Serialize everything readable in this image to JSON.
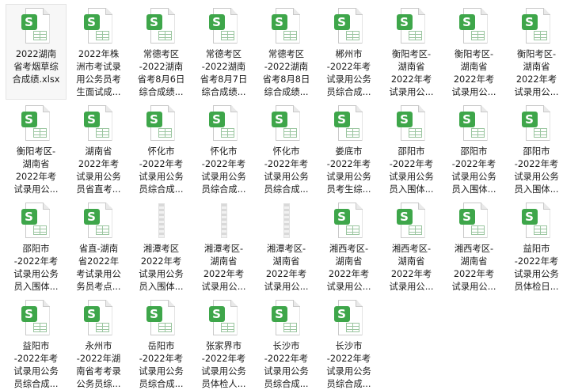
{
  "files": [
    {
      "name": "2022湖南省考烟草综合成绩.xlsx",
      "display": "2022湖南\n省考烟草综\n合成绩.xlsx",
      "icon": "spreadsheet-icon",
      "selected": true
    },
    {
      "name": "2022年株洲市考试录用公务员考生面试成...",
      "display": "2022年株\n洲市考试录\n用公务员考\n生面试成...",
      "icon": "spreadsheet-icon"
    },
    {
      "name": "常德考区-2022湖南省考8月6日综合成绩...",
      "display": "常德考区\n-2022湖南\n省考8月6日\n综合成绩...",
      "icon": "spreadsheet-icon"
    },
    {
      "name": "常德考区-2022湖南省考8月7日综合成绩...",
      "display": "常德考区\n-2022湖南\n省考8月7日\n综合成绩...",
      "icon": "spreadsheet-icon"
    },
    {
      "name": "常德考区-2022湖南省考8月8日综合成绩...",
      "display": "常德考区\n-2022湖南\n省考8月8日\n综合成绩...",
      "icon": "spreadsheet-icon"
    },
    {
      "name": "郴州市-2022年考试录用公务员综合成...",
      "display": "郴州市\n-2022年考\n试录用公务\n员综合成...",
      "icon": "spreadsheet-icon"
    },
    {
      "name": "衡阳考区-湖南省2022年考试录用公...",
      "display": "衡阳考区-\n湖南省\n2022年考\n试录用公...",
      "icon": "spreadsheet-icon"
    },
    {
      "name": "衡阳考区-湖南省2022年考试录用公...",
      "display": "衡阳考区-\n湖南省\n2022年考\n试录用公...",
      "icon": "spreadsheet-icon"
    },
    {
      "name": "衡阳考区-湖南省2022年考试录用公...",
      "display": "衡阳考区-\n湖南省\n2022年考\n试录用公...",
      "icon": "spreadsheet-icon"
    },
    {
      "name": "衡阳考区-湖南省2022年考试录用公...",
      "display": "衡阳考区-\n湖南省\n2022年考\n试录用公...",
      "icon": "spreadsheet-icon"
    },
    {
      "name": "湖南省2022年考试录用公务员省直考...",
      "display": "湖南省\n2022年考\n试录用公务\n员省直考...",
      "icon": "spreadsheet-icon"
    },
    {
      "name": "怀化市-2022年考试录用公务员综合成...",
      "display": "怀化市\n-2022年考\n试录用公务\n员综合成...",
      "icon": "spreadsheet-icon"
    },
    {
      "name": "怀化市-2022年考试录用公务员综合成...",
      "display": "怀化市\n-2022年考\n试录用公务\n员综合成...",
      "icon": "spreadsheet-icon"
    },
    {
      "name": "怀化市-2022年考试录用公务员综合成...",
      "display": "怀化市\n-2022年考\n试录用公务\n员综合成...",
      "icon": "spreadsheet-icon"
    },
    {
      "name": "娄底市-2022年考试录用公务员考生综...",
      "display": "娄底市\n-2022年考\n试录用公务\n员考生综...",
      "icon": "spreadsheet-icon"
    },
    {
      "name": "邵阳市-2022年考试录用公务员入围体...",
      "display": "邵阳市\n-2022年考\n试录用公务\n员入围体...",
      "icon": "spreadsheet-icon"
    },
    {
      "name": "邵阳市-2022年考试录用公务员入围体...",
      "display": "邵阳市\n-2022年考\n试录用公务\n员入围体...",
      "icon": "spreadsheet-icon"
    },
    {
      "name": "邵阳市-2022年考试录用公务员入围体...",
      "display": "邵阳市\n-2022年考\n试录用公务\n员入围体...",
      "icon": "spreadsheet-icon"
    },
    {
      "name": "邵阳市-2022年考试录用公务员入围体...",
      "display": "邵阳市\n-2022年考\n试录用公务\n员入围体...",
      "icon": "spreadsheet-icon"
    },
    {
      "name": "省直-湖南省2022年考试录用公务员考点...",
      "display": "省直-湖南\n省2022年\n考试录用公\n务员考点...",
      "icon": "spreadsheet-icon"
    },
    {
      "name": "湘潭考区2022年考试录用公务员入围体...",
      "display": "湘潭考区\n2022年考\n试录用公务\n员入围体...",
      "icon": "blank-thumbnail-icon"
    },
    {
      "name": "湘潭考区-湖南省2022年考试录用公...",
      "display": "湘潭考区-\n湖南省\n2022年考\n试录用公...",
      "icon": "blank-thumbnail-icon"
    },
    {
      "name": "湘潭考区-湖南省2022年考试录用公...",
      "display": "湘潭考区-\n湖南省\n2022年考\n试录用公...",
      "icon": "blank-thumbnail-icon"
    },
    {
      "name": "湘西考区-湖南省2022年考试录用公...",
      "display": "湘西考区-\n湖南省\n2022年考\n试录用公...",
      "icon": "spreadsheet-icon"
    },
    {
      "name": "湘西考区-湖南省2022年考试录用公...",
      "display": "湘西考区-\n湖南省\n2022年考\n试录用公...",
      "icon": "spreadsheet-icon"
    },
    {
      "name": "湘西考区-湖南省2022年考试录用公...",
      "display": "湘西考区-\n湖南省\n2022年考\n试录用公...",
      "icon": "spreadsheet-icon"
    },
    {
      "name": "益阳市-2022年考试录用公务员体检日...",
      "display": "益阳市\n-2022年考\n试录用公务\n员体检日...",
      "icon": "spreadsheet-icon"
    },
    {
      "name": "益阳市-2022年考试录用公务员综合成...",
      "display": "益阳市\n-2022年考\n试录用公务\n员综合成...",
      "icon": "spreadsheet-icon"
    },
    {
      "name": "永州市-2022年湖南省考考录公务员综...",
      "display": "永州市\n-2022年湖\n南省考考录\n公务员综...",
      "icon": "spreadsheet-icon"
    },
    {
      "name": "岳阳市-2022年考试录用公务员综合成...",
      "display": "岳阳市\n-2022年考\n试录用公务\n员综合成...",
      "icon": "spreadsheet-icon"
    },
    {
      "name": "张家界市-2022年考试录用公务员体检人...",
      "display": "张家界市\n-2022年考\n试录用公务\n员体检人...",
      "icon": "spreadsheet-icon"
    },
    {
      "name": "长沙市-2022年考试录用公务员综合成...",
      "display": "长沙市\n-2022年考\n试录用公务\n员综合成...",
      "icon": "spreadsheet-icon"
    },
    {
      "name": "长沙市-2022年考试录用公务员综合成...",
      "display": "长沙市\n-2022年考\n试录用公务\n员综合成...",
      "icon": "spreadsheet-icon"
    }
  ],
  "badge_letter": "S",
  "colors": {
    "badge": "#3ea64a",
    "selection_bg": "#f7f7f7",
    "selection_border": "#e4e4e4"
  }
}
